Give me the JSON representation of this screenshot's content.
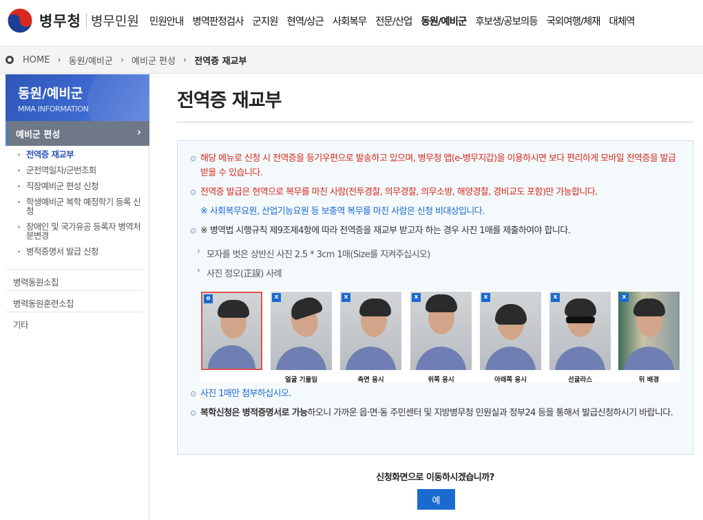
{
  "header": {
    "logo_text": "병무청",
    "site_name": "병무민원",
    "nav": [
      "민원안내",
      "병역판정검사",
      "군지원",
      "현역/상근",
      "사회복무",
      "전문/산업",
      "동원/예비군",
      "후보생/공보의등",
      "국외여행/체재",
      "대체역"
    ],
    "active_nav_index": 6
  },
  "breadcrumb": {
    "home": "HOME",
    "items": [
      "동원/예비군",
      "예비군 편성"
    ],
    "current": "전역증 재교부"
  },
  "sidebar": {
    "title": "동원/예비군",
    "subtitle": "MMA INFORMATION",
    "active_section": "예비군 편성",
    "sub_items": [
      "전역증 재교부",
      "군전역일자/군번조회",
      "직장예비군 편성 신청",
      "학생예비군 복학 예정학기 등록 신청",
      "장애인 및 국가유공 등록자 병역처분변경",
      "병적증명서 발급 신청"
    ],
    "menus": [
      "병력동원소집",
      "병력동원훈련소집",
      "기타"
    ]
  },
  "main": {
    "title": "전역증 재교부",
    "notice": {
      "b1": "해당 메뉴로 신청 시 전역증을 등기우편으로 발송하고 있으며, 병무청 앱(e-병무지갑)을 이용하시면 보다 편리하게 모바일 전역증을 발급 받을 수 있습니다.",
      "b2": "전역증 발급은 현역으로 복무를 마친 사람(전투경찰, 의무경찰, 의무소방, 해양경찰, 경비교도 포함)만 가능합니다.",
      "b2_sub": "※ 사회복무요원, 산업기능요원 등 보충역 복무를 마친 사람은 신청 비대상입니다.",
      "b3": "※ 병역법 시행규칙 제9조제4항에 따라 전역증을 재교부 받고자 하는 경우 사진 1매를 제출하여야 합니다.",
      "b3_sub1": "모자를 벗은 상반신 사진 2.5 * 3cm 1매(Size를 지켜주십시오)",
      "b3_sub2": "사진 정오(正誤) 사례",
      "b4": "사진 1매만 첨부하십시오.",
      "b5_bold": "복학신청은 병적증명서로 가능",
      "b5_rest": "하오니 가까운 읍·면·동 주민센터 및 지방병무청 민원실과 정부24 등을 통해서 발급신청하시기 바랍니다."
    },
    "photos": [
      {
        "mark": "o",
        "caption": ""
      },
      {
        "mark": "x",
        "caption": "얼굴 기울임"
      },
      {
        "mark": "x",
        "caption": "측면 응시"
      },
      {
        "mark": "x",
        "caption": "위쪽 응시"
      },
      {
        "mark": "x",
        "caption": "아래쪽 응시"
      },
      {
        "mark": "x",
        "caption": "선글라스"
      },
      {
        "mark": "x",
        "caption": "뒤 배경"
      }
    ],
    "question": "신청화면으로 이동하시겠습니까?",
    "yes_label": "예"
  }
}
